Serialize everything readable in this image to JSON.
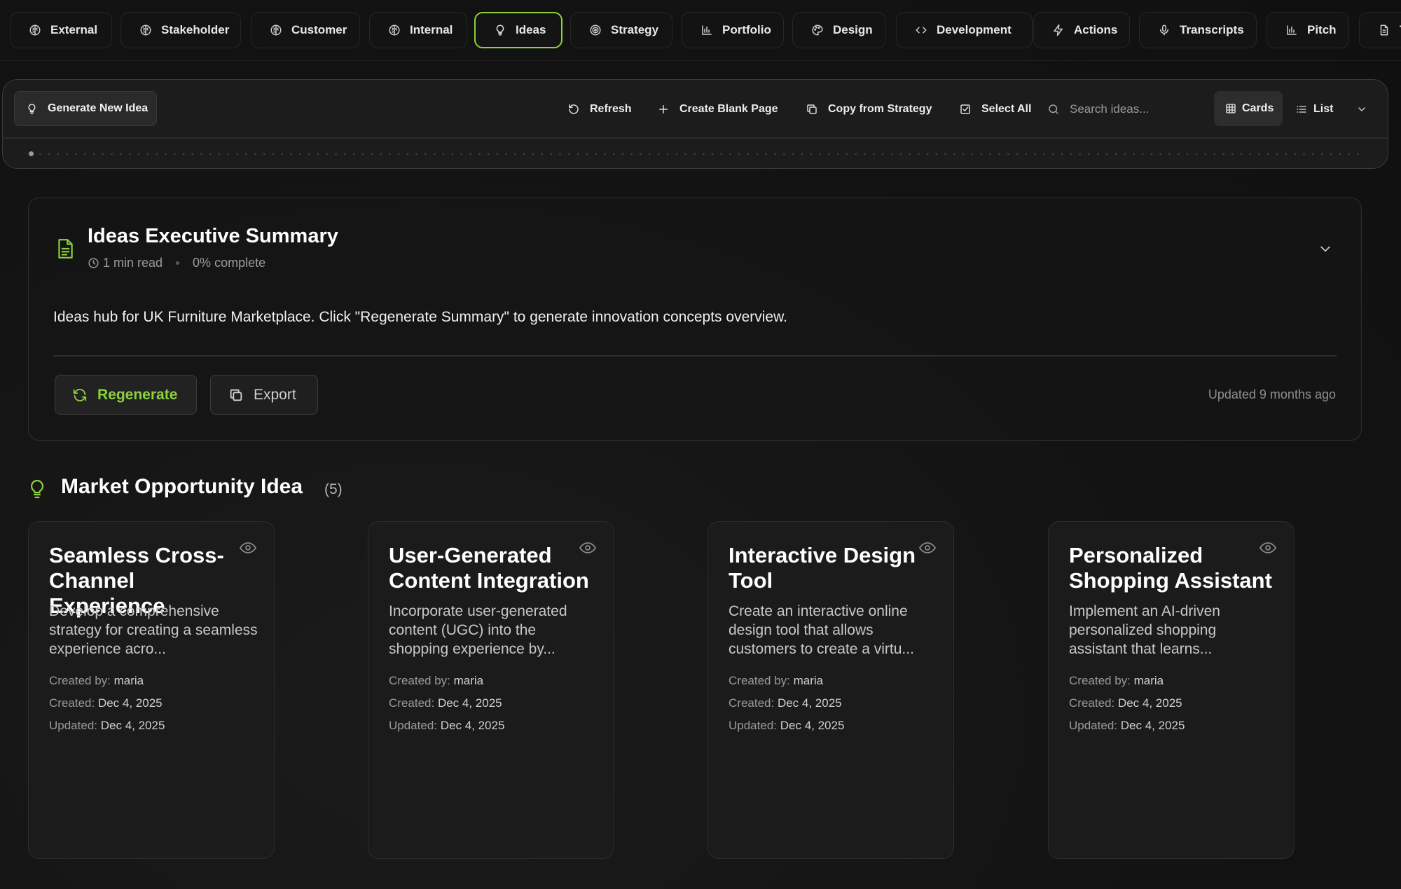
{
  "tabs": [
    {
      "label": "External",
      "icon": "brain-icon",
      "active": false
    },
    {
      "label": "Stakeholder",
      "icon": "brain-icon",
      "active": false
    },
    {
      "label": "Customer",
      "icon": "brain-icon",
      "active": false
    },
    {
      "label": "Internal",
      "icon": "brain-icon",
      "active": false
    },
    {
      "label": "Ideas",
      "icon": "lightbulb-icon",
      "active": true
    },
    {
      "label": "Strategy",
      "icon": "target-icon",
      "active": false
    },
    {
      "label": "Portfolio",
      "icon": "bar-chart-icon",
      "active": false
    },
    {
      "label": "Design",
      "icon": "palette-icon",
      "active": false
    },
    {
      "label": "Development",
      "icon": "code-icon",
      "active": false
    },
    {
      "label": "Actions",
      "icon": "lightning-icon",
      "active": false
    },
    {
      "label": "Transcripts",
      "icon": "microphone-icon",
      "active": false
    },
    {
      "label": "Pitch",
      "icon": "bar-chart-icon",
      "active": false
    },
    {
      "label": "T",
      "icon": "document-icon",
      "active": false
    }
  ],
  "toolbar": {
    "generate_label": "Generate New Idea",
    "refresh_label": "Refresh",
    "create_blank_label": "Create Blank Page",
    "copy_strategy_label": "Copy from Strategy",
    "select_all_label": "Select All",
    "search_placeholder": "Search ideas...",
    "view_cards_label": "Cards",
    "view_list_label": "List"
  },
  "summary": {
    "title": "Ideas Executive Summary",
    "read_time": "1 min read",
    "progress": "0% complete",
    "text": "Ideas hub for UK Furniture Marketplace. Click \"Regenerate Summary\" to generate innovation concepts overview.",
    "regenerate_label": "Regenerate",
    "export_label": "Export",
    "updated": "Updated 9 months ago"
  },
  "section": {
    "title": "Market Opportunity Idea",
    "count": "(5)"
  },
  "card_labels": {
    "created_by": "Created by:",
    "created": "Created:",
    "updated": "Updated:"
  },
  "cards": [
    {
      "title": "Seamless Cross-Channel Experience",
      "description": "Develop a comprehensive strategy for creating a seamless experience acro...",
      "created_by": "maria",
      "created": "Dec 4, 2025",
      "updated": "Dec 4, 2025"
    },
    {
      "title": "User-Generated Content Integration",
      "description": "Incorporate user-generated content (UGC) into the shopping experience by...",
      "created_by": "maria",
      "created": "Dec 4, 2025",
      "updated": "Dec 4, 2025"
    },
    {
      "title": "Interactive Design Tool",
      "description": "Create an interactive online design tool that allows customers to create a virtu...",
      "created_by": "maria",
      "created": "Dec 4, 2025",
      "updated": "Dec 4, 2025"
    },
    {
      "title": "Personalized Shopping Assistant",
      "description": "Implement an AI-driven personalized shopping assistant that learns...",
      "created_by": "maria",
      "created": "Dec 4, 2025",
      "updated": "Dec 4, 2025"
    }
  ],
  "colors": {
    "accent": "#8bd13a",
    "background": "#131313",
    "card": "#1b1b1b"
  }
}
